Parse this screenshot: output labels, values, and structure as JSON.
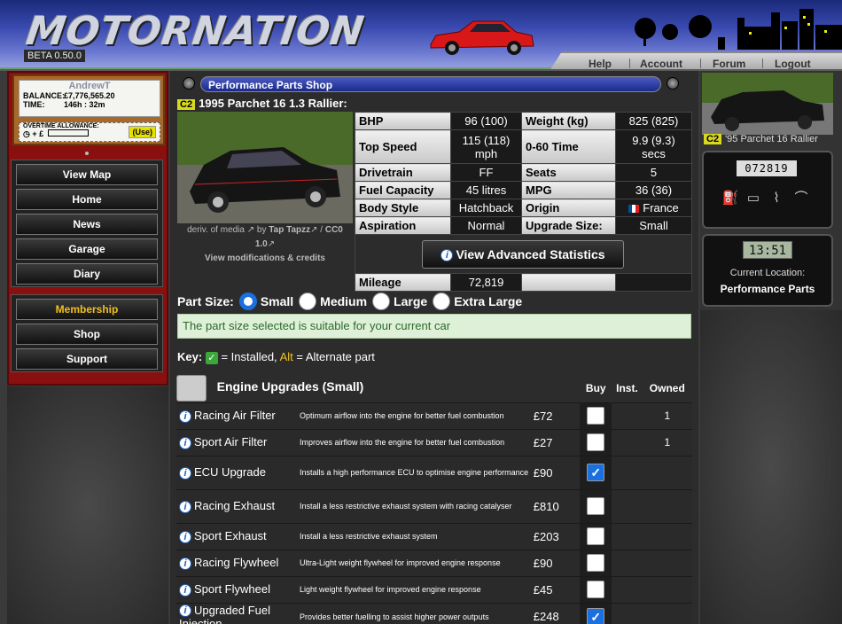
{
  "header": {
    "logo": "MOTORNATION",
    "version": "BETA 0.50.0",
    "nav": [
      "Help",
      "Account",
      "Forum",
      "Logout"
    ]
  },
  "player": {
    "name": "AndrewT",
    "balance_label": "BALANCE:",
    "balance": "£7,776,565.20",
    "time_label": "TIME:",
    "time": "146h : 32m",
    "overtime_label": "OVERTIME ALLOWANCE:",
    "use_label": "(Use)"
  },
  "menu": {
    "main": [
      "View Map",
      "Home",
      "News",
      "Garage",
      "Diary"
    ],
    "secondary": [
      "Membership",
      "Shop",
      "Support"
    ]
  },
  "shop": {
    "title": "Performance Parts Shop",
    "class_badge": "C2",
    "car_name": "1995 Parchet 16 1.3 Rallier:",
    "credits_line1": "deriv. of media",
    "credits_by": "by",
    "credits_author": "Tap Tapzz",
    "credits_license": "CC0 1.0",
    "credits_link": "View modifications & credits",
    "specs": [
      {
        "l1": "BHP",
        "v1": "96 (100)",
        "l2": "Weight (kg)",
        "v2": "825 (825)"
      },
      {
        "l1": "Top Speed",
        "v1": "115 (118) mph",
        "l2": "0-60 Time",
        "v2": "9.9 (9.3) secs"
      },
      {
        "l1": "Drivetrain",
        "v1": "FF",
        "l2": "Seats",
        "v2": "5"
      },
      {
        "l1": "Fuel Capacity",
        "v1": "45 litres",
        "l2": "MPG",
        "v2": "36 (36)"
      },
      {
        "l1": "Body Style",
        "v1": "Hatchback",
        "l2": "Origin",
        "v2": "France"
      },
      {
        "l1": "Aspiration",
        "v1": "Normal",
        "l2": "Upgrade Size:",
        "v2": "Small"
      }
    ],
    "mileage_label": "Mileage",
    "mileage": "72,819",
    "advanced_button": "View Advanced Statistics",
    "part_size_label": "Part Size:",
    "sizes": [
      "Small",
      "Medium",
      "Large",
      "Extra Large"
    ],
    "selected_size": "Small",
    "notice": "The part size selected is suitable for your current car",
    "key_label": "Key:",
    "key_installed": "= Installed,",
    "key_alt": "Alt",
    "key_alt_text": "= Alternate part",
    "section_title": "Engine Upgrades (Small)",
    "col_buy": "Buy",
    "col_inst": "Inst.",
    "col_owned": "Owned",
    "parts": [
      {
        "name": "Racing Air Filter",
        "desc": "Optimum airflow into the engine for better fuel combustion",
        "price": "£72",
        "checked": false,
        "owned": "1"
      },
      {
        "name": "Sport Air Filter",
        "desc": "Improves airflow into the engine for better fuel combustion",
        "price": "£27",
        "checked": false,
        "owned": "1"
      },
      {
        "name": "ECU Upgrade",
        "desc": "Installs a high performance ECU to optimise engine performance",
        "price": "£90",
        "checked": true,
        "owned": ""
      },
      {
        "name": "Racing Exhaust",
        "desc": "Install a less restrictive exhaust system with racing catalyser",
        "price": "£810",
        "checked": false,
        "owned": ""
      },
      {
        "name": "Sport Exhaust",
        "desc": "Install a less restrictive exhaust system",
        "price": "£203",
        "checked": false,
        "owned": ""
      },
      {
        "name": "Racing Flywheel",
        "desc": "Ultra-Light weight flywheel for improved engine response",
        "price": "£90",
        "checked": false,
        "owned": ""
      },
      {
        "name": "Sport Flywheel",
        "desc": "Light weight flywheel for improved engine response",
        "price": "£45",
        "checked": false,
        "owned": ""
      },
      {
        "name": "Upgraded Fuel Injection",
        "desc": "Provides better fuelling to assist higher power outputs",
        "price": "£248",
        "checked": true,
        "owned": ""
      }
    ]
  },
  "sidebar_right": {
    "class_badge": "C2",
    "car_caption": "'95 Parchet 16 Rallier",
    "odometer": "072819",
    "clock": "13:51",
    "location_label": "Current Location:",
    "location": "Performance Parts"
  },
  "colors": {
    "accent_blue": "#1a70e0",
    "badge_yellow": "#d8d820",
    "menu_red": "#8a1010",
    "gold": "#f0c020"
  }
}
